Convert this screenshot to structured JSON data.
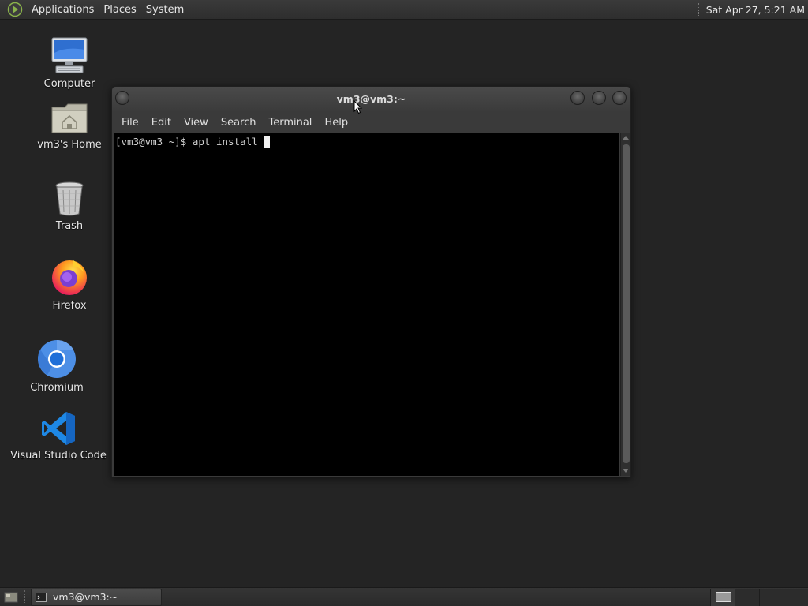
{
  "top_panel": {
    "menus": [
      "Applications",
      "Places",
      "System"
    ],
    "clock": "Sat Apr 27,  5:21 AM",
    "logo_icon": "mate-logo-icon"
  },
  "desktop": {
    "icons": [
      {
        "label": "Computer",
        "icon": "computer-icon"
      },
      {
        "label": "vm3's Home",
        "icon": "home-folder-icon"
      },
      {
        "label": "Trash",
        "icon": "trash-icon"
      },
      {
        "label": "Firefox",
        "icon": "firefox-icon"
      },
      {
        "label": "Chromium",
        "icon": "chromium-icon"
      },
      {
        "label": "Visual Studio Code",
        "icon": "vscode-icon"
      }
    ]
  },
  "window": {
    "title": "vm3@vm3:~",
    "menus": [
      "File",
      "Edit",
      "View",
      "Search",
      "Terminal",
      "Help"
    ],
    "terminal_line": "[vm3@vm3 ~]$ apt install "
  },
  "taskbar": {
    "task_label": "vm3@vm3:~",
    "workspace_count": 4,
    "active_workspace": 1
  },
  "colors": {
    "desktop_bg": "#242424",
    "panel_bg": "#2e2e2e",
    "terminal_bg": "#000000",
    "terminal_fg": "#d0d0d0"
  }
}
